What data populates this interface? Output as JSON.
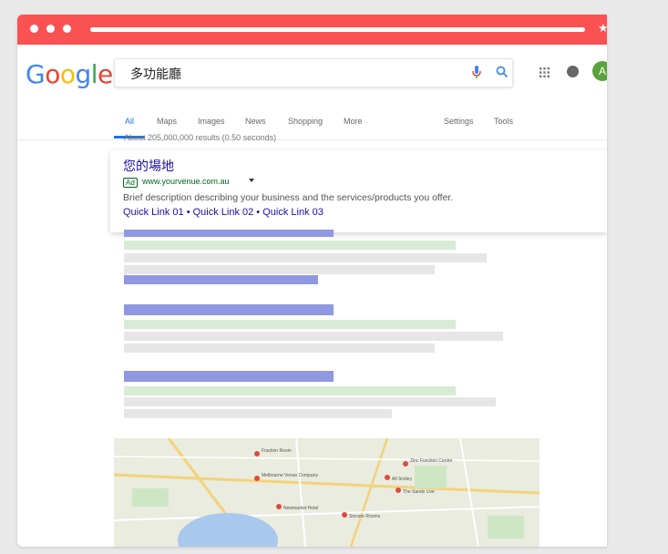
{
  "browser": {
    "title_bar_color": "#fa5252"
  },
  "google": {
    "logo_letters": [
      {
        "ch": "G",
        "color": "#4285f4"
      },
      {
        "ch": "o",
        "color": "#ea4335"
      },
      {
        "ch": "o",
        "color": "#fbbc05"
      },
      {
        "ch": "g",
        "color": "#4285f4"
      },
      {
        "ch": "l",
        "color": "#34a853"
      },
      {
        "ch": "e",
        "color": "#ea4335"
      }
    ],
    "search": {
      "query": "多功能廳"
    },
    "avatar_letter": "A",
    "tabs": [
      {
        "label": "All",
        "active": true
      },
      {
        "label": "Maps"
      },
      {
        "label": "Images"
      },
      {
        "label": "News"
      },
      {
        "label": "Shopping"
      },
      {
        "label": "More"
      }
    ],
    "tools": [
      {
        "label": "Settings"
      },
      {
        "label": "Tools"
      }
    ],
    "result_stats": "About 205,000,000 results (0.50 seconds)",
    "ad": {
      "title": "您的場地",
      "badge": "Ad",
      "url": "www.yourvenue.com.au",
      "description": "Brief description describing your business and the services/products you offer.",
      "quick_links": "Quick Link 01 • Quick Link 02 • Quick Link 03"
    },
    "map": {
      "labels": [
        "Fraction Room",
        "Melbourne Venue Company",
        "Zinc Function Centre",
        "All Smiley",
        "The Sands Live",
        "Newmarket Hotel",
        "Sincere Rooms"
      ]
    }
  }
}
